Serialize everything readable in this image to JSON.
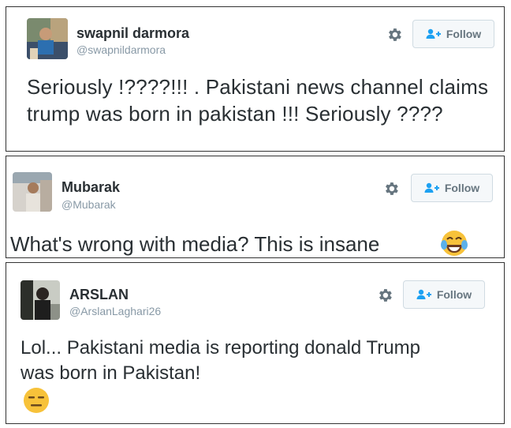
{
  "tweets": [
    {
      "name": "swapnil darmora",
      "handle": "@swapnildarmora",
      "follow_label": "Follow",
      "text": "Seriously !????!!! . Pakistani news channel claims trump was born in pakistan !!!  Seriously ????"
    },
    {
      "name": "Mubarak",
      "handle": "@Mubarak",
      "follow_label": "Follow",
      "text": "What's wrong with media? This is insane",
      "emoji": "face-with-tears-of-joy"
    },
    {
      "name": "ARSLAN",
      "handle": "@ArslanLaghari26",
      "follow_label": "Follow",
      "text": "Lol... Pakistani media is reporting donald Trump was born in Pakistan!",
      "emoji": "expressionless-face"
    }
  ],
  "colors": {
    "text": "#292f33",
    "muted": "#8899a6",
    "accent": "#1da1f2",
    "emoji": "#f7c23a"
  }
}
